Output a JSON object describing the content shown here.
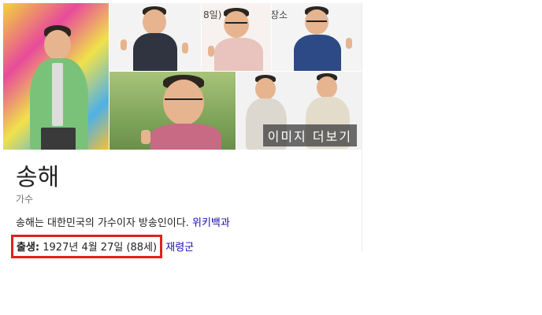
{
  "gallery": {
    "more_images_label": "이미지 더보기",
    "overlay_text": "8일)",
    "overlay_text_2": "장소"
  },
  "entity": {
    "name": "송해",
    "type": "가수",
    "description": "송해는 대한민국의 가수이자 방송인이다.",
    "description_source": "위키백과",
    "birth_label": "출생:",
    "birth_value": "1927년 4월 27일 (88세)",
    "birth_place": "재령군"
  },
  "colors": {
    "highlight_box": "#e0211d",
    "link": "#1a0dab"
  }
}
